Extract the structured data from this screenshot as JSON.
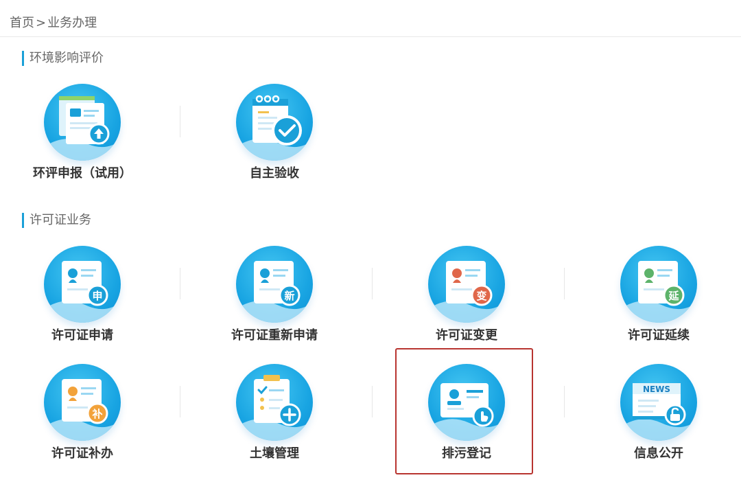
{
  "breadcrumb": {
    "home": "首页",
    "separator": ">",
    "current": "业务办理"
  },
  "sections": [
    {
      "title": "环境影响评价",
      "items": [
        {
          "label": "环评申报（试用）",
          "icon": "document-upload-icon"
        },
        {
          "label": "自主验收",
          "icon": "checklist-approve-icon"
        }
      ]
    },
    {
      "title": "许可证业务",
      "items": [
        {
          "label": "许可证申请",
          "icon": "license-apply-icon",
          "badge": "申"
        },
        {
          "label": "许可证重新申请",
          "icon": "license-reapply-icon",
          "badge": "新"
        },
        {
          "label": "许可证变更",
          "icon": "license-change-icon",
          "badge": "变"
        },
        {
          "label": "许可证延续",
          "icon": "license-extend-icon",
          "badge": "延"
        },
        {
          "label": "许可证补办",
          "icon": "license-reissue-icon",
          "badge": "补"
        },
        {
          "label": "土壤管理",
          "icon": "soil-clipboard-add-icon"
        },
        {
          "label": "排污登记",
          "icon": "discharge-registration-icon"
        },
        {
          "label": "信息公开",
          "icon": "news-unlock-icon",
          "badge": "NEWS"
        }
      ]
    }
  ],
  "colors": {
    "accent": "#1aa0d8",
    "highlight_border": "#b8342f",
    "badge_red": "#e0674a",
    "badge_green": "#5db36a",
    "badge_orange": "#f2a23a"
  }
}
